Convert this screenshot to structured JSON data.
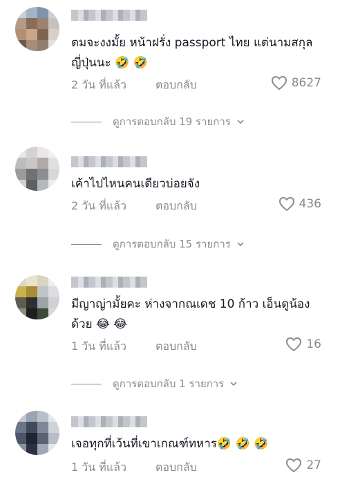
{
  "comments": [
    {
      "text": "ตมจะงงมั้ย หน้าฝรั่ง passport ไทย แต่นามสกุลญี่ปุ่นนะ 🤣 🤣",
      "date": "2 วัน ที่แล้ว",
      "reply_label": "ตอบกลับ",
      "likes": "8627",
      "view_replies": "ดูการตอบกลับ 19 รายการ"
    },
    {
      "text": "เค้าไปไหนคนเดียวบ่อยจัง",
      "date": "2 วัน ที่แล้ว",
      "reply_label": "ตอบกลับ",
      "likes": "436",
      "view_replies": "ดูการตอบกลับ 15 รายการ"
    },
    {
      "text": "มีญาญ่ามั้ยคะ ห่างจากณเดช 10 ก้าว เอ็นดูน้องด้วย 😂 😂",
      "date": "1 วัน ที่แล้ว",
      "reply_label": "ตอบกลับ",
      "likes": "16",
      "view_replies": "ดูการตอบกลับ 1 รายการ"
    },
    {
      "text": "เจอทุกที่เว้นที่เขาเกณฑ์ทหาร🤣 🤣 🤣",
      "date": "1 วัน ที่แล้ว",
      "reply_label": "ตอบกลับ",
      "likes": "27"
    }
  ],
  "colors": {
    "text": "#161823",
    "muted": "#8a8b91"
  },
  "icons": {
    "like": "heart-outline-icon",
    "expand": "chevron-down-icon"
  }
}
